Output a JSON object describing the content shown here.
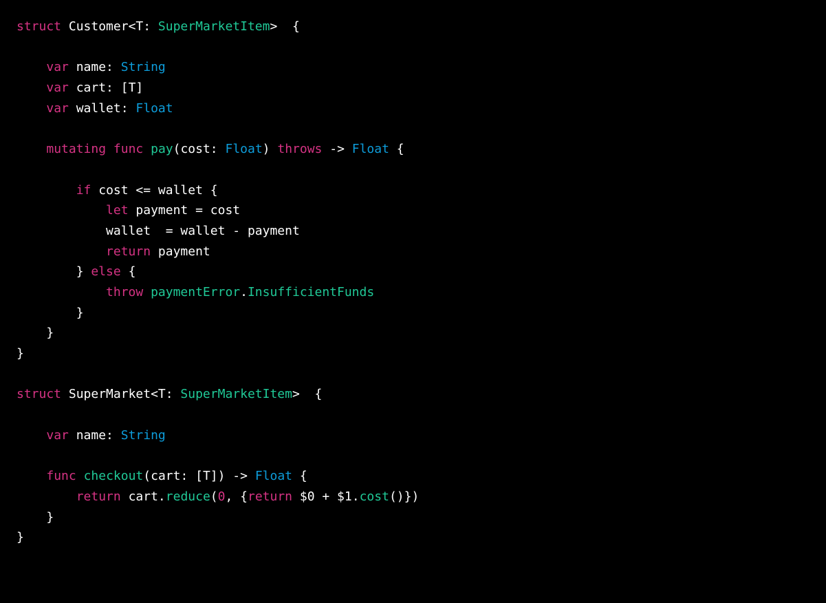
{
  "code": {
    "lines": [
      {
        "tokens": [
          {
            "cls": "tok-keyword-magenta",
            "text": "struct"
          },
          {
            "cls": "tok-white",
            "text": " Customer<T: "
          },
          {
            "cls": "tok-type-green",
            "text": "SuperMarketItem"
          },
          {
            "cls": "tok-white",
            "text": ">  {"
          }
        ]
      },
      {
        "tokens": [
          {
            "cls": "tok-white",
            "text": ""
          }
        ]
      },
      {
        "tokens": [
          {
            "cls": "tok-white",
            "text": "    "
          },
          {
            "cls": "tok-keyword-magenta",
            "text": "var"
          },
          {
            "cls": "tok-white",
            "text": " name: "
          },
          {
            "cls": "tok-type-blue",
            "text": "String"
          }
        ]
      },
      {
        "tokens": [
          {
            "cls": "tok-white",
            "text": "    "
          },
          {
            "cls": "tok-keyword-magenta",
            "text": "var"
          },
          {
            "cls": "tok-white",
            "text": " cart: [T]"
          }
        ]
      },
      {
        "tokens": [
          {
            "cls": "tok-white",
            "text": "    "
          },
          {
            "cls": "tok-keyword-magenta",
            "text": "var"
          },
          {
            "cls": "tok-white",
            "text": " wallet: "
          },
          {
            "cls": "tok-type-blue",
            "text": "Float"
          }
        ]
      },
      {
        "tokens": [
          {
            "cls": "tok-white",
            "text": ""
          }
        ]
      },
      {
        "tokens": [
          {
            "cls": "tok-white",
            "text": "    "
          },
          {
            "cls": "tok-keyword-magenta",
            "text": "mutating"
          },
          {
            "cls": "tok-white",
            "text": " "
          },
          {
            "cls": "tok-keyword-magenta",
            "text": "func"
          },
          {
            "cls": "tok-white",
            "text": " "
          },
          {
            "cls": "tok-type-green",
            "text": "pay"
          },
          {
            "cls": "tok-white",
            "text": "(cost: "
          },
          {
            "cls": "tok-type-blue",
            "text": "Float"
          },
          {
            "cls": "tok-white",
            "text": ") "
          },
          {
            "cls": "tok-keyword-magenta",
            "text": "throws"
          },
          {
            "cls": "tok-white",
            "text": " -> "
          },
          {
            "cls": "tok-type-blue",
            "text": "Float"
          },
          {
            "cls": "tok-white",
            "text": " {"
          }
        ]
      },
      {
        "tokens": [
          {
            "cls": "tok-white",
            "text": ""
          }
        ]
      },
      {
        "tokens": [
          {
            "cls": "tok-white",
            "text": "        "
          },
          {
            "cls": "tok-keyword-magenta",
            "text": "if"
          },
          {
            "cls": "tok-white",
            "text": " cost <= wallet {"
          }
        ]
      },
      {
        "tokens": [
          {
            "cls": "tok-white",
            "text": "            "
          },
          {
            "cls": "tok-keyword-magenta",
            "text": "let"
          },
          {
            "cls": "tok-white",
            "text": " payment = cost"
          }
        ]
      },
      {
        "tokens": [
          {
            "cls": "tok-white",
            "text": "            wallet  = wallet - payment"
          }
        ]
      },
      {
        "tokens": [
          {
            "cls": "tok-white",
            "text": "            "
          },
          {
            "cls": "tok-keyword-magenta",
            "text": "return"
          },
          {
            "cls": "tok-white",
            "text": " payment"
          }
        ]
      },
      {
        "tokens": [
          {
            "cls": "tok-white",
            "text": "        } "
          },
          {
            "cls": "tok-keyword-magenta",
            "text": "else"
          },
          {
            "cls": "tok-white",
            "text": " {"
          }
        ]
      },
      {
        "tokens": [
          {
            "cls": "tok-white",
            "text": "            "
          },
          {
            "cls": "tok-keyword-magenta",
            "text": "throw"
          },
          {
            "cls": "tok-white",
            "text": " "
          },
          {
            "cls": "tok-type-green",
            "text": "paymentError"
          },
          {
            "cls": "tok-white",
            "text": "."
          },
          {
            "cls": "tok-type-green",
            "text": "InsufficientFunds"
          }
        ]
      },
      {
        "tokens": [
          {
            "cls": "tok-white",
            "text": "        }"
          }
        ]
      },
      {
        "tokens": [
          {
            "cls": "tok-white",
            "text": "    }"
          }
        ]
      },
      {
        "tokens": [
          {
            "cls": "tok-white",
            "text": "}"
          }
        ]
      },
      {
        "tokens": [
          {
            "cls": "tok-white",
            "text": ""
          }
        ]
      },
      {
        "tokens": [
          {
            "cls": "tok-keyword-magenta",
            "text": "struct"
          },
          {
            "cls": "tok-white",
            "text": " SuperMarket<T: "
          },
          {
            "cls": "tok-type-green",
            "text": "SuperMarketItem"
          },
          {
            "cls": "tok-white",
            "text": ">  {"
          }
        ]
      },
      {
        "tokens": [
          {
            "cls": "tok-white",
            "text": ""
          }
        ]
      },
      {
        "tokens": [
          {
            "cls": "tok-white",
            "text": "    "
          },
          {
            "cls": "tok-keyword-magenta",
            "text": "var"
          },
          {
            "cls": "tok-white",
            "text": " name: "
          },
          {
            "cls": "tok-type-blue",
            "text": "String"
          }
        ]
      },
      {
        "tokens": [
          {
            "cls": "tok-white",
            "text": ""
          }
        ]
      },
      {
        "tokens": [
          {
            "cls": "tok-white",
            "text": "    "
          },
          {
            "cls": "tok-keyword-magenta",
            "text": "func"
          },
          {
            "cls": "tok-white",
            "text": " "
          },
          {
            "cls": "tok-type-green",
            "text": "checkout"
          },
          {
            "cls": "tok-white",
            "text": "(cart: [T]) -> "
          },
          {
            "cls": "tok-type-blue",
            "text": "Float"
          },
          {
            "cls": "tok-white",
            "text": " {"
          }
        ]
      },
      {
        "tokens": [
          {
            "cls": "tok-white",
            "text": "        "
          },
          {
            "cls": "tok-keyword-magenta",
            "text": "return"
          },
          {
            "cls": "tok-white",
            "text": " cart."
          },
          {
            "cls": "tok-type-green",
            "text": "reduce"
          },
          {
            "cls": "tok-white",
            "text": "("
          },
          {
            "cls": "tok-keyword-magenta",
            "text": "0"
          },
          {
            "cls": "tok-white",
            "text": ", {"
          },
          {
            "cls": "tok-keyword-magenta",
            "text": "return"
          },
          {
            "cls": "tok-white",
            "text": " $0 + $1."
          },
          {
            "cls": "tok-type-green",
            "text": "cost"
          },
          {
            "cls": "tok-white",
            "text": "()})"
          }
        ]
      },
      {
        "tokens": [
          {
            "cls": "tok-white",
            "text": "    }"
          }
        ]
      },
      {
        "tokens": [
          {
            "cls": "tok-white",
            "text": "}"
          }
        ]
      }
    ]
  }
}
